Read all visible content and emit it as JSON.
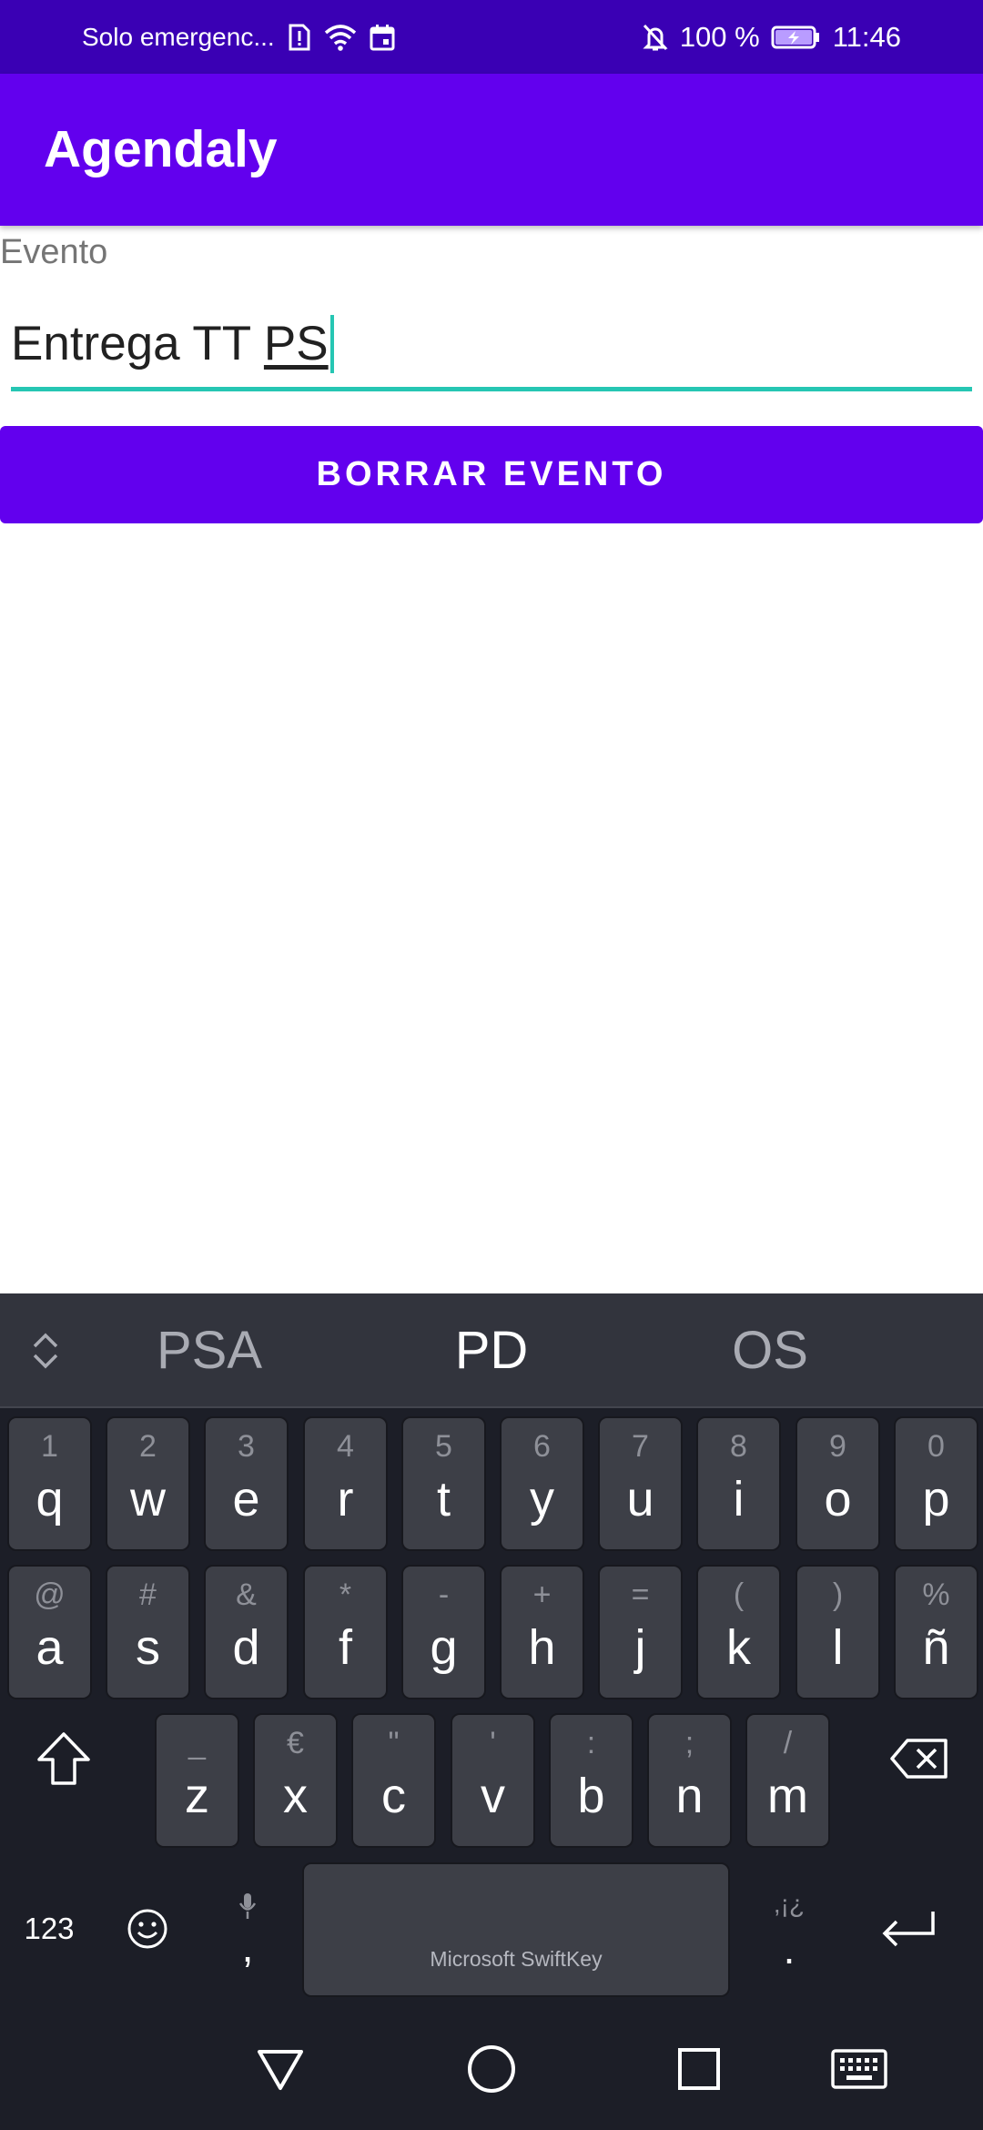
{
  "status_bar": {
    "carrier": "Solo emergenc...",
    "battery": "100 %",
    "time": "11:46",
    "icons": [
      "sim-alert-icon",
      "wifi-icon",
      "calendar-icon",
      "bell-off-icon",
      "battery-charging-icon"
    ]
  },
  "app_bar": {
    "title": "Agendaly",
    "color": "#6200ee"
  },
  "form": {
    "label": "Evento",
    "value_main": "Entrega TT ",
    "value_composing": "PS",
    "delete_button": "BORRAR EVENTO",
    "accent": "#26c6b3"
  },
  "keyboard": {
    "suggestions": [
      "PSA",
      "PD",
      "OS"
    ],
    "row1": [
      {
        "p": "q",
        "s": "1"
      },
      {
        "p": "w",
        "s": "2"
      },
      {
        "p": "e",
        "s": "3"
      },
      {
        "p": "r",
        "s": "4"
      },
      {
        "p": "t",
        "s": "5"
      },
      {
        "p": "y",
        "s": "6"
      },
      {
        "p": "u",
        "s": "7"
      },
      {
        "p": "i",
        "s": "8"
      },
      {
        "p": "o",
        "s": "9"
      },
      {
        "p": "p",
        "s": "0"
      }
    ],
    "row2": [
      {
        "p": "a",
        "s": "@"
      },
      {
        "p": "s",
        "s": "#"
      },
      {
        "p": "d",
        "s": "&"
      },
      {
        "p": "f",
        "s": "*"
      },
      {
        "p": "g",
        "s": "-"
      },
      {
        "p": "h",
        "s": "+"
      },
      {
        "p": "j",
        "s": "="
      },
      {
        "p": "k",
        "s": "("
      },
      {
        "p": "l",
        "s": ")"
      },
      {
        "p": "ñ",
        "s": "%"
      }
    ],
    "row3": [
      {
        "p": "z",
        "s": "_"
      },
      {
        "p": "x",
        "s": "€"
      },
      {
        "p": "c",
        "s": "\""
      },
      {
        "p": "v",
        "s": "'"
      },
      {
        "p": "b",
        "s": ":"
      },
      {
        "p": "n",
        "s": ";"
      },
      {
        "p": "m",
        "s": "/"
      }
    ],
    "numbers_key": "123",
    "comma_key": ",",
    "period_key": ".",
    "period_secondary": ",¡¿",
    "space_label": "Microsoft SwiftKey"
  },
  "nav_bar": {
    "buttons": [
      "back-icon",
      "home-icon",
      "recents-icon",
      "keyboard-switch-icon"
    ]
  }
}
